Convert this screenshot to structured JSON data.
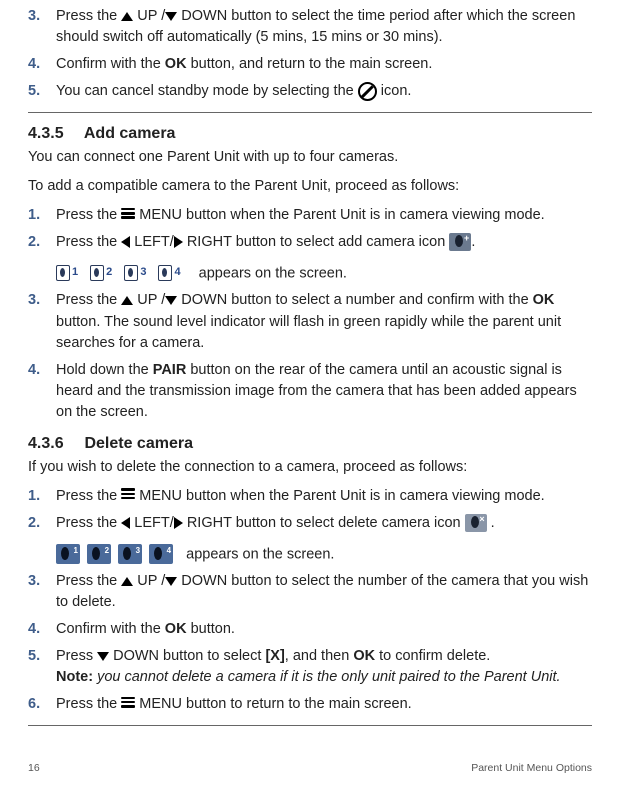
{
  "topList": {
    "item3": {
      "num": "3.",
      "part1": "Press the ",
      "part2": " UP /",
      "part3": " DOWN button to select the time period after which the screen should switch off automatically (5 mins, 15 mins or 30 mins)."
    },
    "item4": {
      "num": "4.",
      "part1": "Confirm with the ",
      "ok": "OK",
      "part2": " button, and return to the main screen."
    },
    "item5": {
      "num": "5.",
      "part1": "You can cancel standby mode by selecting the ",
      "part2": " icon."
    }
  },
  "section435": {
    "number": "4.3.5",
    "title": "Add camera",
    "intro1": "You can connect one Parent Unit with up to four cameras.",
    "intro2": "To add a compatible camera to the Parent Unit, proceed as follows:",
    "item1": {
      "num": "1.",
      "part1": "Press the ",
      "part2": " MENU button when the Parent Unit is in camera viewing mode."
    },
    "item2": {
      "num": "2.",
      "part1": "Press the ",
      "part2": " LEFT/",
      "part3": " RIGHT button to select add camera icon ",
      "part4": "."
    },
    "appears": " appears on the screen.",
    "camNumbers": [
      "1",
      "2",
      "3",
      "4"
    ],
    "item3": {
      "num": "3.",
      "part1": "Press the ",
      "part2": " UP /",
      "part3": " DOWN button to select a number and confirm with the ",
      "ok": "OK",
      "part4": " button. The sound level indicator will flash in green rapidly while the parent unit searches for a camera."
    },
    "item4": {
      "num": "4.",
      "part1": "Hold down the ",
      "pair": "PAIR",
      "part2": " button on the rear of the camera until an acoustic signal is heard and the transmission image from the camera that has been added appears on the screen."
    }
  },
  "section436": {
    "number": "4.3.6",
    "title": "Delete camera",
    "intro": "If you wish to delete the connection to a camera, proceed as follows:",
    "item1": {
      "num": "1.",
      "part1": "Press the ",
      "part2": " MENU button when the Parent Unit is in camera viewing mode."
    },
    "item2": {
      "num": "2.",
      "part1": "Press the ",
      "part2": " LEFT/",
      "part3": " RIGHT button to select delete camera icon ",
      "part4": " ."
    },
    "appears": " appears on the screen.",
    "camNumbers": [
      "1",
      "2",
      "3",
      "4"
    ],
    "item3": {
      "num": "3.",
      "part1": "Press the ",
      "part2": " UP /",
      "part3": " DOWN button to select the number of the camera that you wish to delete."
    },
    "item4": {
      "num": "4.",
      "part1": "Confirm with the ",
      "ok": "OK",
      "part2": " button."
    },
    "item5": {
      "num": "5.",
      "part1": "Press ",
      "part2": " DOWN button to select ",
      "bracket": "[X]",
      "part3": ", and then ",
      "ok": "OK",
      "part4": " to confirm delete.",
      "noteLabel": "Note:",
      "noteText": " you cannot delete a camera if it is the only unit paired to the Parent Unit."
    },
    "item6": {
      "num": "6.",
      "part1": "Press the ",
      "part2": " MENU button to return to the main screen."
    }
  },
  "footer": {
    "page": "16",
    "title": "Parent Unit Menu Options"
  }
}
